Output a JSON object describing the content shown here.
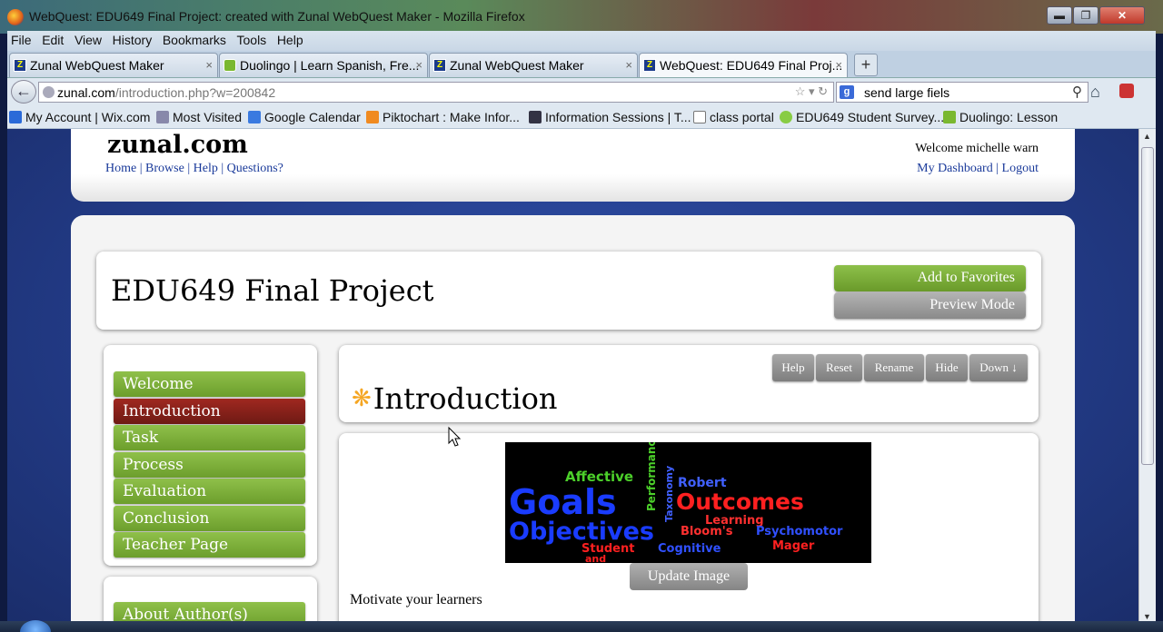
{
  "window": {
    "title": "WebQuest: EDU649 Final Project: created with Zunal WebQuest Maker - Mozilla Firefox",
    "minimize": "▬",
    "restore": "❐",
    "close": "✕"
  },
  "menu": [
    "File",
    "Edit",
    "View",
    "History",
    "Bookmarks",
    "Tools",
    "Help"
  ],
  "tabs": [
    {
      "label": "Zunal WebQuest Maker",
      "icon": "zunal-icon"
    },
    {
      "label": "Duolingo | Learn Spanish, Fre...",
      "icon": "duolingo-icon"
    },
    {
      "label": "Zunal WebQuest Maker",
      "icon": "zunal-icon"
    },
    {
      "label": "WebQuest: EDU649 Final Proj...",
      "icon": "zunal-icon"
    }
  ],
  "newtab": "+",
  "nav": {
    "back": "←",
    "url_domain": "zunal.com",
    "url_path": "/introduction.php?w=200842",
    "search_engine": "g",
    "search_value": "send large fiels",
    "search_icon": "⚲",
    "home_icon": "⌂"
  },
  "bookmarks": [
    "My Account | Wix.com",
    "Most Visited",
    "Google Calendar",
    "Piktochart : Make Infor...",
    "Information Sessions | T...",
    "class portal",
    "EDU649 Student Survey...",
    "Duolingo: Lesson"
  ],
  "site": {
    "logo": "zunal.com",
    "toplinks": [
      "Home",
      "Browse",
      "Help",
      "Questions?"
    ],
    "welcome": "Welcome michelle warn",
    "dashboard": "My Dashboard",
    "logout": "Logout"
  },
  "project": {
    "title": "EDU649 Final Project",
    "add_favorites": "Add to Favorites",
    "preview_mode": "Preview Mode"
  },
  "sidebar": {
    "items": [
      "Welcome",
      "Introduction",
      "Task",
      "Process",
      "Evaluation",
      "Conclusion",
      "Teacher Page"
    ],
    "active": "Introduction",
    "about": "About Author(s)"
  },
  "section": {
    "heading": "Introduction",
    "buttons": [
      "Help",
      "Reset",
      "Rename",
      "Hide",
      "Down ↓"
    ],
    "update_image": "Update Image",
    "text": "Motivate your learners"
  },
  "wordcloud": {
    "words": [
      "Goals",
      "Outcomes",
      "Objectives",
      "Affective",
      "Performance",
      "Taxonomy",
      "Robert",
      "Learning",
      "Bloom's",
      "Psychomotor",
      "Student",
      "and",
      "Cognitive",
      "Mager"
    ]
  },
  "colors": {
    "nav_green": "#7aae38",
    "nav_active": "#8a2219",
    "button_grey": "#9a9a9a",
    "page_bg": "#2a4595"
  }
}
